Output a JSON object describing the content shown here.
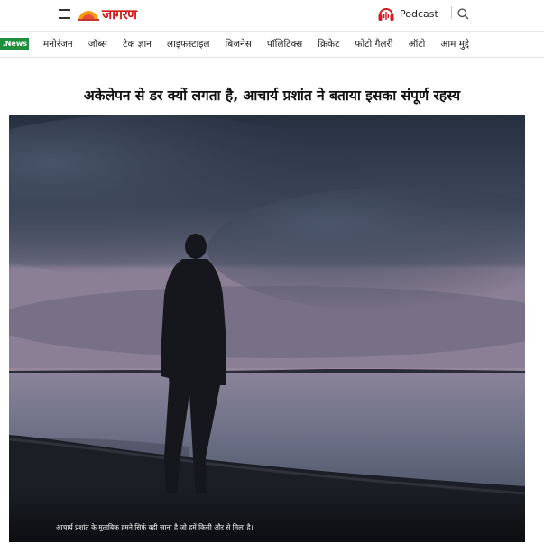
{
  "header": {
    "logo_text": "जागरण",
    "podcast_label": "Podcast",
    "icons": [
      "menu-icon",
      "sun-logo-icon",
      "podcast-icon",
      "search-icon"
    ]
  },
  "nav": {
    "badge": ".News",
    "items": [
      "मनोरंजन",
      "जॉब्स",
      "टेक ज्ञान",
      "लाइफस्टाइल",
      "बिजनेस",
      "पॉलिटिक्स",
      "क्रिकेट",
      "फोटो गैलरी",
      "ऑटो",
      "आम मुद्दे"
    ]
  },
  "article": {
    "headline": "अकेलेपन से डर क्यों लगता है, आचार्य प्रशांत ने बताया इसका संपूर्ण रहस्य",
    "image_caption": "आचार्य प्रशांत के मुताबिक हमने सिर्फ वही जाना है जो हमें किसी और से मिला है।"
  },
  "colors": {
    "brand_red": "#d21a1a",
    "news_badge_green": "#1f8f3e",
    "sky_dark": "#2c3646",
    "lake": "#6f7486"
  }
}
